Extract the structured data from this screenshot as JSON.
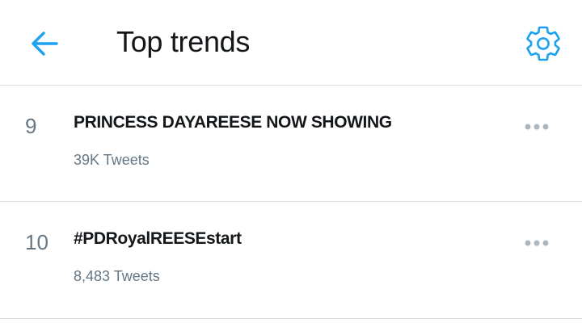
{
  "header": {
    "title": "Top trends",
    "back_icon": "arrow-left-icon",
    "settings_icon": "gear-icon"
  },
  "trends": [
    {
      "rank": "9",
      "name": "PRINCESS DAYAREESE NOW SHOWING",
      "count": "39K Tweets",
      "more_icon": "more-horizontal-icon"
    },
    {
      "rank": "10",
      "name": "#PDRoyalREESEstart",
      "count": "8,483 Tweets",
      "more_icon": "more-horizontal-icon"
    }
  ],
  "colors": {
    "accent": "#1da1f2",
    "text_primary": "#14171a",
    "text_secondary": "#657786",
    "divider": "#d9dee2",
    "icon_muted": "#aab8c2"
  }
}
